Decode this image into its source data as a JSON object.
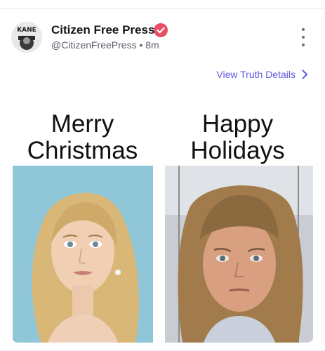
{
  "post": {
    "author_name": "Citizen Free Press",
    "handle": "@CitizenFreePress",
    "separator": "•",
    "time_ago": "8m",
    "avatar_text": "KANE",
    "verified_icon": "verified-badge-icon",
    "more_icon": "more-vertical-icon",
    "details_link": "View Truth Details",
    "details_icon": "chevron-right-icon"
  },
  "meme": {
    "left_caption_line1": "Merry",
    "left_caption_line2": "Christmas",
    "right_caption_line1": "Happy",
    "right_caption_line2": "Holidays"
  },
  "colors": {
    "accent": "#5e5be3",
    "verified": "#e94f64",
    "text": "#16161a",
    "muted": "#5d5d69"
  }
}
